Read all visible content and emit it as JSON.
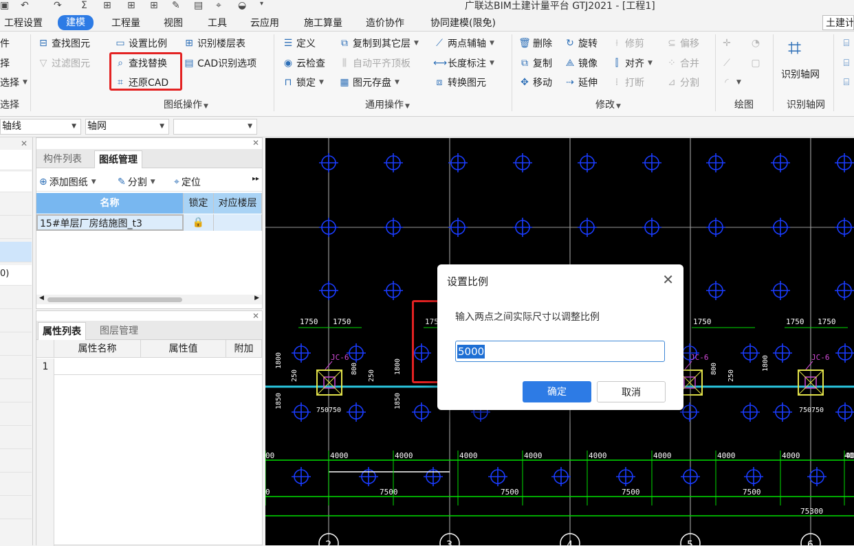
{
  "window": {
    "title": "广联达BIM土建计量平台 GTJ2021 - [工程1]"
  },
  "menubar": {
    "items": [
      "工程设置",
      "建模",
      "工程量",
      "视图",
      "工具",
      "云应用",
      "施工算量",
      "造价协作",
      "协同建模(限免)"
    ],
    "active": "建模",
    "right": "土建计"
  },
  "ribbon": {
    "left_cut": {
      "r1": "件",
      "r2": "择",
      "r3": "选择",
      "r4": "选择"
    },
    "cad": {
      "find": "查找图元",
      "filter": "过滤图元",
      "set_scale": "设置比例",
      "find_replace": "查找替换",
      "restore": "还原CAD",
      "floor_table": "识别楼层表",
      "cad_options": "CAD识别选项",
      "group": "图纸操作"
    },
    "common": {
      "define": "定义",
      "cloud_check": "云检查",
      "lock": "锁定",
      "copy_layer": "复制到其它层",
      "auto_flush": "自动平齐顶板",
      "save_disk": "图元存盘",
      "two_point": "两点辅轴",
      "dim": "长度标注",
      "convert": "转换图元",
      "group": "通用操作"
    },
    "modify": {
      "delete": "删除",
      "copy": "复制",
      "move": "移动",
      "rotate": "旋转",
      "mirror": "镜像",
      "extend": "延伸",
      "trim": "修剪",
      "align": "对齐",
      "break": "打断",
      "offset": "偏移",
      "merge": "合并",
      "split": "分割",
      "group": "修改"
    },
    "draw": {
      "group": "绘图"
    },
    "axis": {
      "button": "识别轴网",
      "group": "识别轴网"
    }
  },
  "filterbar": {
    "combo1": "轴线",
    "combo2": "轴网",
    "combo3": ""
  },
  "left_strip": {
    "partial": "0)"
  },
  "drawing_panel": {
    "tabs": [
      "构件列表",
      "图纸管理"
    ],
    "active_tab": "图纸管理",
    "tools": {
      "add": "添加图纸",
      "split": "分割",
      "locate": "定位"
    },
    "columns": [
      "名称",
      "锁定",
      "对应楼层"
    ],
    "rows": [
      {
        "name": "15#单层厂房结施图_t3",
        "locked": true,
        "floor": ""
      }
    ]
  },
  "property_panel": {
    "tabs": [
      "属性列表",
      "图层管理"
    ],
    "active_tab": "属性列表",
    "columns": [
      "属性名称",
      "属性值",
      "附加"
    ],
    "rows": [
      "1"
    ]
  },
  "dialog": {
    "title": "设置比例",
    "prompt": "输入两点之间实际尺寸以调整比例",
    "value": "5000",
    "ok": "确定",
    "cancel": "取消"
  },
  "cad": {
    "dims_top": [
      "1750",
      "1750",
      "1750",
      "1750",
      "1750",
      "1750"
    ],
    "dims_row": [
      "4000",
      "4000",
      "4000",
      "4000",
      "4000",
      "4000",
      "4000",
      "4000",
      "4000",
      "4000"
    ],
    "dims_7500": [
      "7500",
      "7500",
      "7500",
      "7500"
    ],
    "dim_total": "75300",
    "dim_edge_left": "00",
    "dim_edge_left2": "0",
    "dim_edge_right": "40",
    "dims_750": [
      "750",
      "750"
    ],
    "dims_side": [
      "1800",
      "1850",
      "250",
      "800",
      "600"
    ],
    "tags": [
      "JC-6",
      "JC-6",
      "JC-6"
    ],
    "axis_labels": [
      "2",
      "3",
      "4",
      "5",
      "6"
    ]
  },
  "colors": {
    "accent": "#2d7be5",
    "highlight": "#e32222",
    "cad_green": "#00e000",
    "cad_blue": "#1a3cff",
    "cad_cyan": "#2ac7e0",
    "cad_magenta": "#d24bd8",
    "cad_yellow": "#e3e34a"
  }
}
